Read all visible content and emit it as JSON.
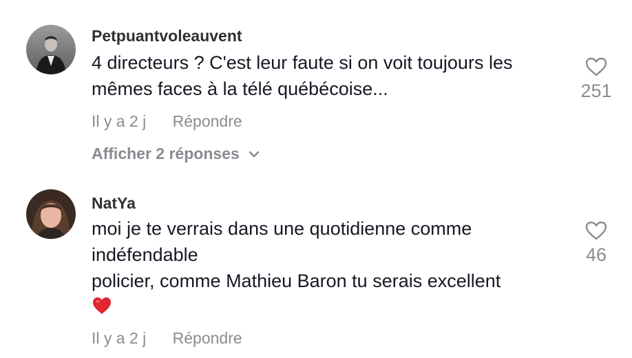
{
  "comments": [
    {
      "username": "Petpuantvoleauvent",
      "lines": [
        "4 directeurs ? C'est leur faute si on voit toujours les",
        "mêmes faces à la télé québécoise..."
      ],
      "time": "Il y a 2 j",
      "reply_label": "Répondre",
      "likes": "251",
      "replies_label": "Afficher 2 réponses"
    },
    {
      "username": "NatYa",
      "lines": [
        "moi je te verrais dans une quotidienne comme",
        "indéfendable",
        "policier, comme Mathieu Baron tu serais excellent"
      ],
      "time": "Il y a 2 j",
      "reply_label": "Répondre",
      "likes": "46"
    }
  ],
  "icons": {
    "like": "heart-outline-icon",
    "expand": "chevron-down-icon",
    "emoji": "red-heart-emoji"
  },
  "colors": {
    "username": "#2f2f34",
    "text": "#161823",
    "muted": "#8a8b91",
    "emoji_heart": "#e0262f"
  }
}
